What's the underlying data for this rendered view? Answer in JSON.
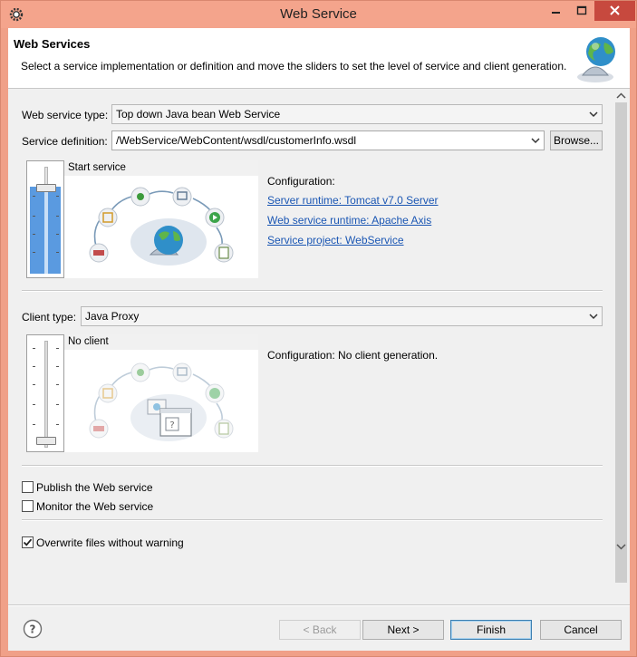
{
  "window": {
    "title": "Web Service"
  },
  "header": {
    "title": "Web Services",
    "description": "Select a service implementation or definition and move the sliders to set the level of service and client generation."
  },
  "service": {
    "type_label": "Web service type:",
    "type_value": "Top down Java bean Web Service",
    "definition_label": "Service definition:",
    "definition_value": "/WebService/WebContent/wsdl/customerInfo.wsdl",
    "browse_label": "Browse...",
    "slider_level": "Start service",
    "slider_position_fraction": 0.5,
    "config_label": "Configuration:",
    "links": [
      "Server runtime: Tomcat v7.0 Server",
      "Web service runtime: Apache Axis",
      "Service project: WebService"
    ]
  },
  "client": {
    "type_label": "Client type:",
    "type_value": "Java Proxy",
    "slider_level": "No client",
    "slider_position_fraction": 1.0,
    "config_label": "Configuration: No client generation."
  },
  "options": {
    "publish": {
      "label": "Publish the Web service",
      "checked": false
    },
    "monitor": {
      "label": "Monitor the Web service",
      "checked": false
    },
    "overwrite": {
      "label": "Overwrite files without warning",
      "checked": true
    }
  },
  "buttons": {
    "back": "< Back",
    "next": "Next >",
    "finish": "Finish",
    "cancel": "Cancel"
  },
  "icons": {
    "app": "eclipse-gear-icon",
    "header": "globe-icon",
    "help": "help-icon"
  },
  "colors": {
    "title_bar": "#f4a48c",
    "close_button": "#c7493e",
    "link": "#1a56b3",
    "slider_active": "#5a9ae0"
  }
}
